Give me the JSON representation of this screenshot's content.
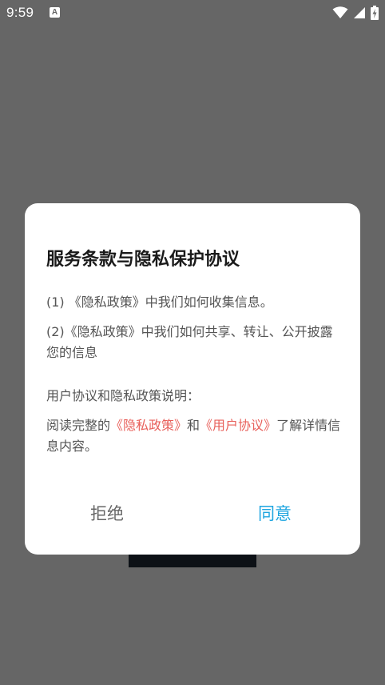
{
  "status_bar": {
    "time": "9:59",
    "notification_icon_letter": "A",
    "icons": [
      "wifi-icon",
      "signal-icon",
      "battery-charging-icon"
    ]
  },
  "dialog": {
    "title": "服务条款与隐私保护协议",
    "items": [
      "(1) 《隐私政策》中我们如何收集信息。",
      "(2)《隐私政策》中我们如何共享、转让、公开披露您的信息"
    ],
    "explanation_heading": "用户协议和隐私政策说明：",
    "read_prefix": "阅读完整的",
    "privacy_policy_link": "《隐私政策》",
    "and_text": "和",
    "user_agreement_link": "《用户协议》",
    "read_suffix": "了解详情信息内容。",
    "reject_label": "拒绝",
    "agree_label": "同意"
  },
  "colors": {
    "overlay": "#666666",
    "link": "#e8605b",
    "agree": "#1fa6e0",
    "reject": "#666666"
  }
}
